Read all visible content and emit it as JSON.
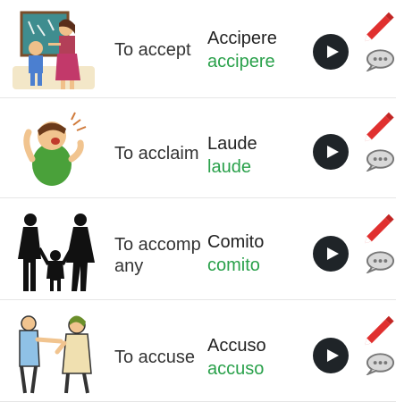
{
  "rows": [
    {
      "english": "To accept",
      "latin": "Accipere",
      "latin_lower": "accipere",
      "illustration": "teacher-student-classroom-image"
    },
    {
      "english": "To acclaim",
      "latin": "Laude",
      "latin_lower": "laude",
      "illustration": "cheering-person-image"
    },
    {
      "english": "To accompany",
      "latin": "Comito",
      "latin_lower": "comito",
      "illustration": "family-silhouette-image"
    },
    {
      "english": "To accuse",
      "latin": "Accuso",
      "latin_lower": "accuso",
      "illustration": "pointing-accusation-image"
    }
  ],
  "icons": {
    "play": "play-icon",
    "edit": "pencil-icon",
    "speech": "speech-bubble-icon"
  },
  "colors": {
    "latin_green": "#2aa14b",
    "play_bg": "#1f2428",
    "edit_red": "#e0302f"
  }
}
